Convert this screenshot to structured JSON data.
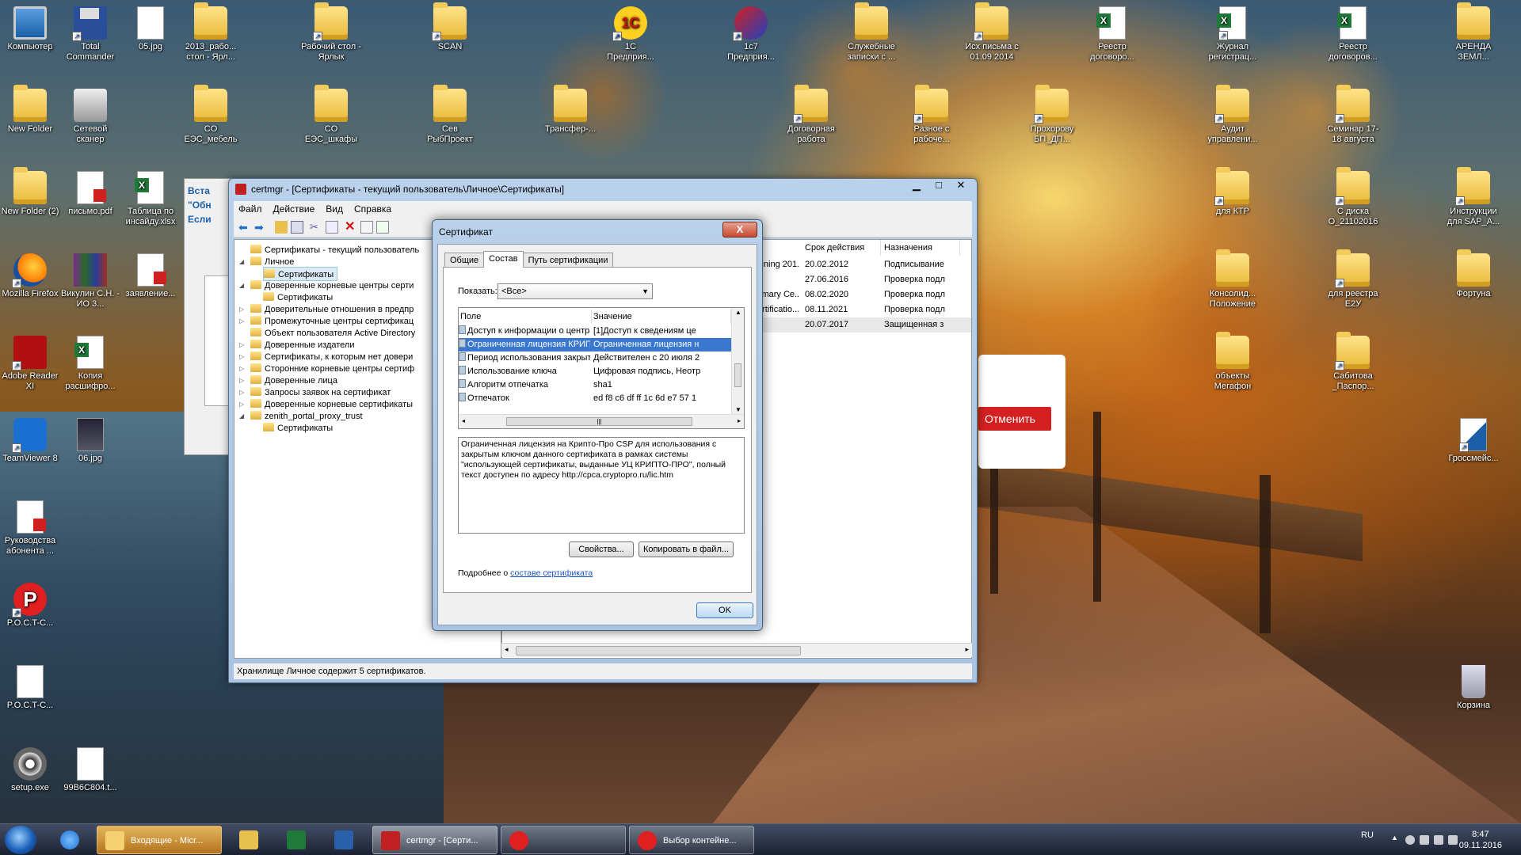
{
  "desktop": {
    "icons_left": [
      {
        "label": "Компьютер",
        "icon": "computer-icon"
      },
      {
        "label": "Total Commander",
        "icon": "floppy-icon"
      },
      {
        "label": "05.jpg",
        "icon": "image-icon"
      },
      {
        "label": "2013_рабо... стол - Ярл...",
        "icon": "folder-icon"
      },
      {
        "label": "New Folder",
        "icon": "folder-icon"
      },
      {
        "label": "Сетевой сканер",
        "icon": "scanner-icon"
      },
      {
        "label": "New Folder (2)",
        "icon": "folder-icon"
      },
      {
        "label": "письмо.pdf",
        "icon": "pdf-icon"
      },
      {
        "label": "Таблица по инсайду.xlsx",
        "icon": "excel-icon"
      },
      {
        "label": "Mozilla Firefox",
        "icon": "firefox-icon"
      },
      {
        "label": "Викулин С.Н. - ИО 3...",
        "icon": "winrar-icon"
      },
      {
        "label": "заявление...",
        "icon": "pdf-icon"
      },
      {
        "label": "Adobe Reader XI",
        "icon": "adobe-icon"
      },
      {
        "label": "Копия расшифро...",
        "icon": "excel-icon"
      },
      {
        "label": "TeamViewer 8",
        "icon": "teamviewer-icon"
      },
      {
        "label": "06.jpg",
        "icon": "image-icon"
      },
      {
        "label": "Руководства абонента ...",
        "icon": "pdf-icon"
      },
      {
        "label": "P.O.C.T-C...",
        "icon": "rost-icon"
      },
      {
        "label": "P.O.C.T-C...",
        "icon": "document-icon"
      },
      {
        "label": "setup.exe",
        "icon": "setup-icon"
      },
      {
        "label": "99B6C804.t...",
        "icon": "document-icon"
      }
    ],
    "icons_top": [
      {
        "label": "Рабочий стол - Ярлык",
        "icon": "folder-icon"
      },
      {
        "label": "SCAN",
        "icon": "folder-icon"
      },
      {
        "label": "1С Предприя...",
        "icon": "onec-icon"
      },
      {
        "label": "1с7 Предприя...",
        "icon": "onec7-icon"
      },
      {
        "label": "Служебные записки с ...",
        "icon": "folder-icon"
      },
      {
        "label": "Исх письма с 01.09.2014",
        "icon": "folder-icon"
      },
      {
        "label": "Реестр договоро...",
        "icon": "excel-icon"
      },
      {
        "label": "Журнал регистрац...",
        "icon": "excel-icon"
      },
      {
        "label": "Реестр договоров...",
        "icon": "excel-icon"
      },
      {
        "label": "АРЕНДА ЗЕМЛ...",
        "icon": "folder-icon"
      },
      {
        "label": "CO ЕЭС_мебель",
        "icon": "folder-icon"
      },
      {
        "label": "CO ЕЭС_шкафы",
        "icon": "folder-icon"
      },
      {
        "label": "Сев РыбПроект",
        "icon": "folder-icon"
      },
      {
        "label": "Трансфер-...",
        "icon": "folder-icon"
      },
      {
        "label": "Договорная работа",
        "icon": "folder-icon"
      },
      {
        "label": "Разное с рабоче...",
        "icon": "folder-icon"
      },
      {
        "label": "Прохорову БП_ДП...",
        "icon": "folder-icon"
      },
      {
        "label": "Аудит управлени...",
        "icon": "folder-icon"
      },
      {
        "label": "Семинар 17-18 августа",
        "icon": "folder-icon"
      },
      {
        "label": "для КТР",
        "icon": "folder-icon"
      },
      {
        "label": "С диска O_21102016",
        "icon": "folder-icon"
      },
      {
        "label": "Инструкции для SAP_A...",
        "icon": "folder-icon"
      },
      {
        "label": "Консолид... Положение",
        "icon": "folder-icon"
      },
      {
        "label": "для реестра E2У",
        "icon": "folder-icon"
      },
      {
        "label": "Фортуна",
        "icon": "folder-icon"
      },
      {
        "label": "объекты Мегафон",
        "icon": "folder-icon"
      },
      {
        "label": "Сабитова _Паспор...",
        "icon": "folder-icon"
      },
      {
        "label": "Гроссмейс...",
        "icon": "blue-doc-icon"
      },
      {
        "label": "Корзина",
        "icon": "recycle-bin-icon"
      }
    ]
  },
  "bg_dialog": {
    "line1": "Вста",
    "line2": "\"Обн",
    "line3": "Если"
  },
  "red_panel": {
    "cancel": "Отменить"
  },
  "certmgr": {
    "title": "certmgr - [Сертификаты - текущий пользователь\\Личное\\Сертификаты]",
    "menu": [
      "Файл",
      "Действие",
      "Вид",
      "Справка"
    ],
    "tree": [
      {
        "label": "Сертификаты - текущий пользователь",
        "level": 0,
        "arrow": ""
      },
      {
        "label": "Личное",
        "level": 1,
        "arrow": "◢"
      },
      {
        "label": "Сертификаты",
        "level": 2,
        "arrow": "",
        "selected": true
      },
      {
        "label": "Доверенные корневые центры серти",
        "level": 1,
        "arrow": "◢"
      },
      {
        "label": "Сертификаты",
        "level": 2,
        "arrow": ""
      },
      {
        "label": "Доверительные отношения в предпр",
        "level": 1,
        "arrow": "▷"
      },
      {
        "label": "Промежуточные центры сертификац",
        "level": 1,
        "arrow": "▷"
      },
      {
        "label": "Объект пользователя Active Directory",
        "level": 1,
        "arrow": ""
      },
      {
        "label": "Доверенные издатели",
        "level": 1,
        "arrow": "▷"
      },
      {
        "label": "Сертификаты, к которым нет довери",
        "level": 1,
        "arrow": "▷"
      },
      {
        "label": "Сторонние корневые центры сертиф",
        "level": 1,
        "arrow": "▷"
      },
      {
        "label": "Доверенные лица",
        "level": 1,
        "arrow": "▷"
      },
      {
        "label": "Запросы заявок на сертификат",
        "level": 1,
        "arrow": "▷"
      },
      {
        "label": "Доверенные корневые сертификаты",
        "level": 1,
        "arrow": "▷"
      },
      {
        "label": "zenith_portal_proxy_trust",
        "level": 1,
        "arrow": "◢"
      },
      {
        "label": "Сертификаты",
        "level": 2,
        "arrow": ""
      }
    ],
    "columns": {
      "expiry": "Срок действия",
      "purpose": "Назначения"
    },
    "rows": [
      {
        "issuer": "Signing 201...",
        "expiry": "20.02.2012",
        "purpose": "Подписывание"
      },
      {
        "issuer": "er",
        "expiry": "27.06.2016",
        "purpose": "Проверка подл"
      },
      {
        "issuer": "Primary Ce...",
        "expiry": "08.02.2020",
        "purpose": "Проверка подл"
      },
      {
        "issuer": "Certificatio...",
        "expiry": "08.11.2021",
        "purpose": "Проверка подл"
      },
      {
        "issuer": "",
        "expiry": "20.07.2017",
        "purpose": "Защищенная з",
        "selected": true
      }
    ],
    "status": "Хранилище Личное содержит 5 сертификатов."
  },
  "cert_dialog": {
    "title": "Сертификат",
    "close": "X",
    "tabs": [
      "Общие",
      "Состав",
      "Путь сертификации"
    ],
    "active_tab": 1,
    "show_label": "Показать:",
    "show_value": "<Все>",
    "grid_headers": {
      "field": "Поле",
      "value": "Значение"
    },
    "grid_rows": [
      {
        "field": "Доступ к информации о центрах се...",
        "value": "[1]Доступ к сведениям це"
      },
      {
        "field": "Ограниченная лицензия КРИПТО-П...",
        "value": "Ограниченная лицензия н",
        "selected": true
      },
      {
        "field": "Период использования закрытого ...",
        "value": "Действителен с 20 июля 2"
      },
      {
        "field": "Использование ключа",
        "value": "Цифровая подпись, Неотр"
      },
      {
        "field": "Алгоритм отпечатка",
        "value": "sha1"
      },
      {
        "field": "Отпечаток",
        "value": "ed f8 c6 df ff 1c 6d e7 57 1"
      }
    ],
    "description": "Ограниченная лицензия на Крипто-Про CSP для использования с закрытым ключом данного сертификата в рамках системы \"использующей сертификаты, выданные УЦ КРИПТО-ПРО\", полный текст доступен по адресу http://cpca.cryptopro.ru/lic.htm",
    "properties_btn": "Свойства...",
    "copy_btn": "Копировать в файл...",
    "more_prefix": "Подробнее о",
    "more_link": "составе сертификата",
    "ok": "OK"
  },
  "taskbar": {
    "items": [
      {
        "label": "Входящие - Micr...",
        "icon": "outlook-icon"
      },
      {
        "label": "certmgr - [Серти...",
        "icon": "certmgr-icon"
      },
      {
        "label": "",
        "icon": "rost-icon"
      },
      {
        "label": "Выбор контейне...",
        "icon": "rost-icon"
      }
    ],
    "lang": "RU",
    "time": "8:47",
    "date": "09.11.2016"
  },
  "colors": {
    "accent": "#1a5fa8",
    "selection": "#3a78d0",
    "cancel_red": "#d42020"
  }
}
